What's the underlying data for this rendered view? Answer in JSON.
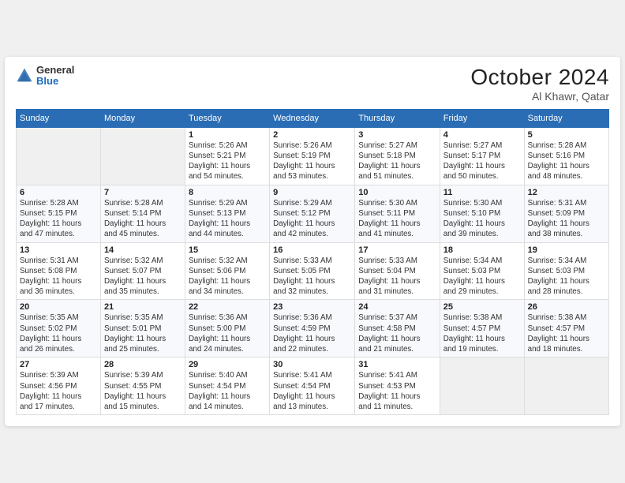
{
  "header": {
    "logo": {
      "general": "General",
      "blue": "Blue"
    },
    "month": "October 2024",
    "location": "Al Khawr, Qatar"
  },
  "weekdays": [
    "Sunday",
    "Monday",
    "Tuesday",
    "Wednesday",
    "Thursday",
    "Friday",
    "Saturday"
  ],
  "weeks": [
    [
      {
        "day": "",
        "detail": ""
      },
      {
        "day": "",
        "detail": ""
      },
      {
        "day": "1",
        "detail": "Sunrise: 5:26 AM\nSunset: 5:21 PM\nDaylight: 11 hours\nand 54 minutes."
      },
      {
        "day": "2",
        "detail": "Sunrise: 5:26 AM\nSunset: 5:19 PM\nDaylight: 11 hours\nand 53 minutes."
      },
      {
        "day": "3",
        "detail": "Sunrise: 5:27 AM\nSunset: 5:18 PM\nDaylight: 11 hours\nand 51 minutes."
      },
      {
        "day": "4",
        "detail": "Sunrise: 5:27 AM\nSunset: 5:17 PM\nDaylight: 11 hours\nand 50 minutes."
      },
      {
        "day": "5",
        "detail": "Sunrise: 5:28 AM\nSunset: 5:16 PM\nDaylight: 11 hours\nand 48 minutes."
      }
    ],
    [
      {
        "day": "6",
        "detail": "Sunrise: 5:28 AM\nSunset: 5:15 PM\nDaylight: 11 hours\nand 47 minutes."
      },
      {
        "day": "7",
        "detail": "Sunrise: 5:28 AM\nSunset: 5:14 PM\nDaylight: 11 hours\nand 45 minutes."
      },
      {
        "day": "8",
        "detail": "Sunrise: 5:29 AM\nSunset: 5:13 PM\nDaylight: 11 hours\nand 44 minutes."
      },
      {
        "day": "9",
        "detail": "Sunrise: 5:29 AM\nSunset: 5:12 PM\nDaylight: 11 hours\nand 42 minutes."
      },
      {
        "day": "10",
        "detail": "Sunrise: 5:30 AM\nSunset: 5:11 PM\nDaylight: 11 hours\nand 41 minutes."
      },
      {
        "day": "11",
        "detail": "Sunrise: 5:30 AM\nSunset: 5:10 PM\nDaylight: 11 hours\nand 39 minutes."
      },
      {
        "day": "12",
        "detail": "Sunrise: 5:31 AM\nSunset: 5:09 PM\nDaylight: 11 hours\nand 38 minutes."
      }
    ],
    [
      {
        "day": "13",
        "detail": "Sunrise: 5:31 AM\nSunset: 5:08 PM\nDaylight: 11 hours\nand 36 minutes."
      },
      {
        "day": "14",
        "detail": "Sunrise: 5:32 AM\nSunset: 5:07 PM\nDaylight: 11 hours\nand 35 minutes."
      },
      {
        "day": "15",
        "detail": "Sunrise: 5:32 AM\nSunset: 5:06 PM\nDaylight: 11 hours\nand 34 minutes."
      },
      {
        "day": "16",
        "detail": "Sunrise: 5:33 AM\nSunset: 5:05 PM\nDaylight: 11 hours\nand 32 minutes."
      },
      {
        "day": "17",
        "detail": "Sunrise: 5:33 AM\nSunset: 5:04 PM\nDaylight: 11 hours\nand 31 minutes."
      },
      {
        "day": "18",
        "detail": "Sunrise: 5:34 AM\nSunset: 5:03 PM\nDaylight: 11 hours\nand 29 minutes."
      },
      {
        "day": "19",
        "detail": "Sunrise: 5:34 AM\nSunset: 5:03 PM\nDaylight: 11 hours\nand 28 minutes."
      }
    ],
    [
      {
        "day": "20",
        "detail": "Sunrise: 5:35 AM\nSunset: 5:02 PM\nDaylight: 11 hours\nand 26 minutes."
      },
      {
        "day": "21",
        "detail": "Sunrise: 5:35 AM\nSunset: 5:01 PM\nDaylight: 11 hours\nand 25 minutes."
      },
      {
        "day": "22",
        "detail": "Sunrise: 5:36 AM\nSunset: 5:00 PM\nDaylight: 11 hours\nand 24 minutes."
      },
      {
        "day": "23",
        "detail": "Sunrise: 5:36 AM\nSunset: 4:59 PM\nDaylight: 11 hours\nand 22 minutes."
      },
      {
        "day": "24",
        "detail": "Sunrise: 5:37 AM\nSunset: 4:58 PM\nDaylight: 11 hours\nand 21 minutes."
      },
      {
        "day": "25",
        "detail": "Sunrise: 5:38 AM\nSunset: 4:57 PM\nDaylight: 11 hours\nand 19 minutes."
      },
      {
        "day": "26",
        "detail": "Sunrise: 5:38 AM\nSunset: 4:57 PM\nDaylight: 11 hours\nand 18 minutes."
      }
    ],
    [
      {
        "day": "27",
        "detail": "Sunrise: 5:39 AM\nSunset: 4:56 PM\nDaylight: 11 hours\nand 17 minutes."
      },
      {
        "day": "28",
        "detail": "Sunrise: 5:39 AM\nSunset: 4:55 PM\nDaylight: 11 hours\nand 15 minutes."
      },
      {
        "day": "29",
        "detail": "Sunrise: 5:40 AM\nSunset: 4:54 PM\nDaylight: 11 hours\nand 14 minutes."
      },
      {
        "day": "30",
        "detail": "Sunrise: 5:41 AM\nSunset: 4:54 PM\nDaylight: 11 hours\nand 13 minutes."
      },
      {
        "day": "31",
        "detail": "Sunrise: 5:41 AM\nSunset: 4:53 PM\nDaylight: 11 hours\nand 11 minutes."
      },
      {
        "day": "",
        "detail": ""
      },
      {
        "day": "",
        "detail": ""
      }
    ]
  ]
}
